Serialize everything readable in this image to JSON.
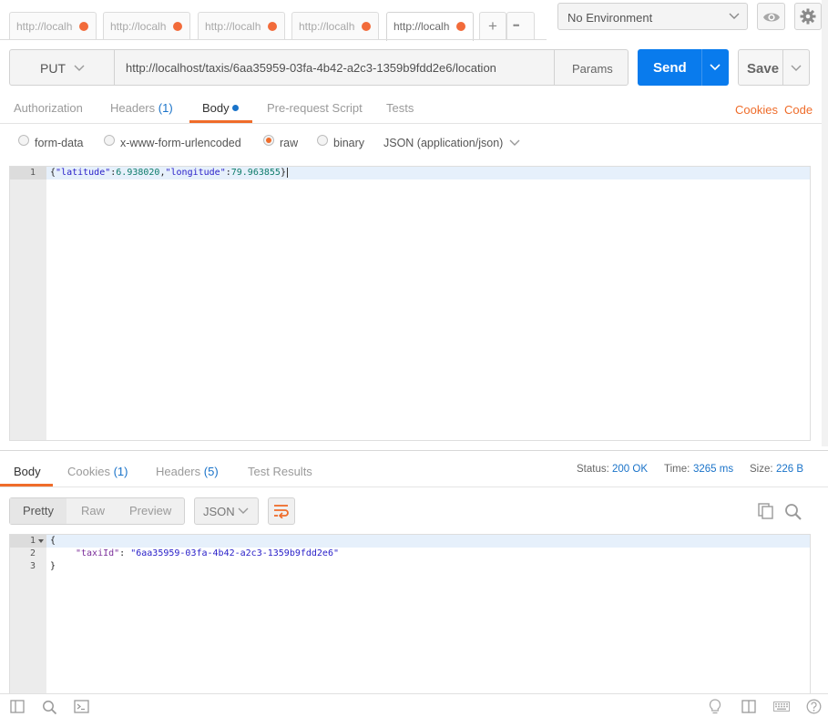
{
  "tabs": [
    {
      "label": "http://localhost/taxis",
      "active": false
    },
    {
      "label": "http://localhost/taxis",
      "active": false
    },
    {
      "label": "http://localhost/taxis",
      "active": false
    },
    {
      "label": "http://localhost/taxis",
      "active": false
    },
    {
      "label": "http://localhost/taxis",
      "active": true
    }
  ],
  "tab_actions": {
    "add": "+",
    "more": "•••"
  },
  "environment": {
    "selected": "No Environment"
  },
  "request": {
    "method": "PUT",
    "url": "http://localhost/taxis/6aa35959-03fa-4b42-a2c3-1359b9fdd2e6/location",
    "params_label": "Params",
    "send_label": "Send",
    "save_label": "Save"
  },
  "request_tabs": {
    "authorization": "Authorization",
    "headers": "Headers",
    "headers_count": "(1)",
    "body": "Body",
    "prerequest": "Pre-request Script",
    "tests": "Tests",
    "cookies": "Cookies",
    "code": "Code"
  },
  "body_modes": {
    "form_data": "form-data",
    "urlencoded": "x-www-form-urlencoded",
    "raw": "raw",
    "binary": "binary",
    "selected": "raw",
    "content_type": "JSON (application/json)"
  },
  "request_body": {
    "line_number": "1",
    "open": "{",
    "key1": "\"latitude\"",
    "colon1": ":",
    "val1": "6.938020",
    "comma": ",",
    "key2": "\"longitude\"",
    "colon2": ":",
    "val2": "79.963855",
    "close": "}"
  },
  "response_tabs": {
    "body": "Body",
    "cookies": "Cookies",
    "cookies_count": "(1)",
    "headers": "Headers",
    "headers_count": "(5)",
    "test_results": "Test Results"
  },
  "response_meta": {
    "status_label": "Status:",
    "status_value": "200 OK",
    "time_label": "Time:",
    "time_value": "3265 ms",
    "size_label": "Size:",
    "size_value": "226 B"
  },
  "response_view": {
    "pretty": "Pretty",
    "raw": "Raw",
    "preview": "Preview",
    "format": "JSON"
  },
  "response_body": {
    "line_numbers": [
      "1",
      "2",
      "3"
    ],
    "open": "{",
    "key": "\"taxiId\"",
    "colon": ": ",
    "value": "\"6aa35959-03fa-4b42-a2c3-1359b9fdd2e6\"",
    "close": "}"
  },
  "colors": {
    "accent_orange": "#ef6c2a",
    "send_blue": "#097bed",
    "link_blue": "#1a73c9"
  },
  "icons": {
    "eye": "eye-icon",
    "settings": "gear-icon",
    "copy": "copy-icon",
    "search": "search-icon",
    "wrap": "wrap-lines-icon",
    "sidebar": "sidebar-toggle-icon",
    "console": "console-icon",
    "bulb": "lightbulb-icon",
    "two_pane": "two-pane-icon",
    "keyboard": "keyboard-icon",
    "help": "help-icon"
  }
}
